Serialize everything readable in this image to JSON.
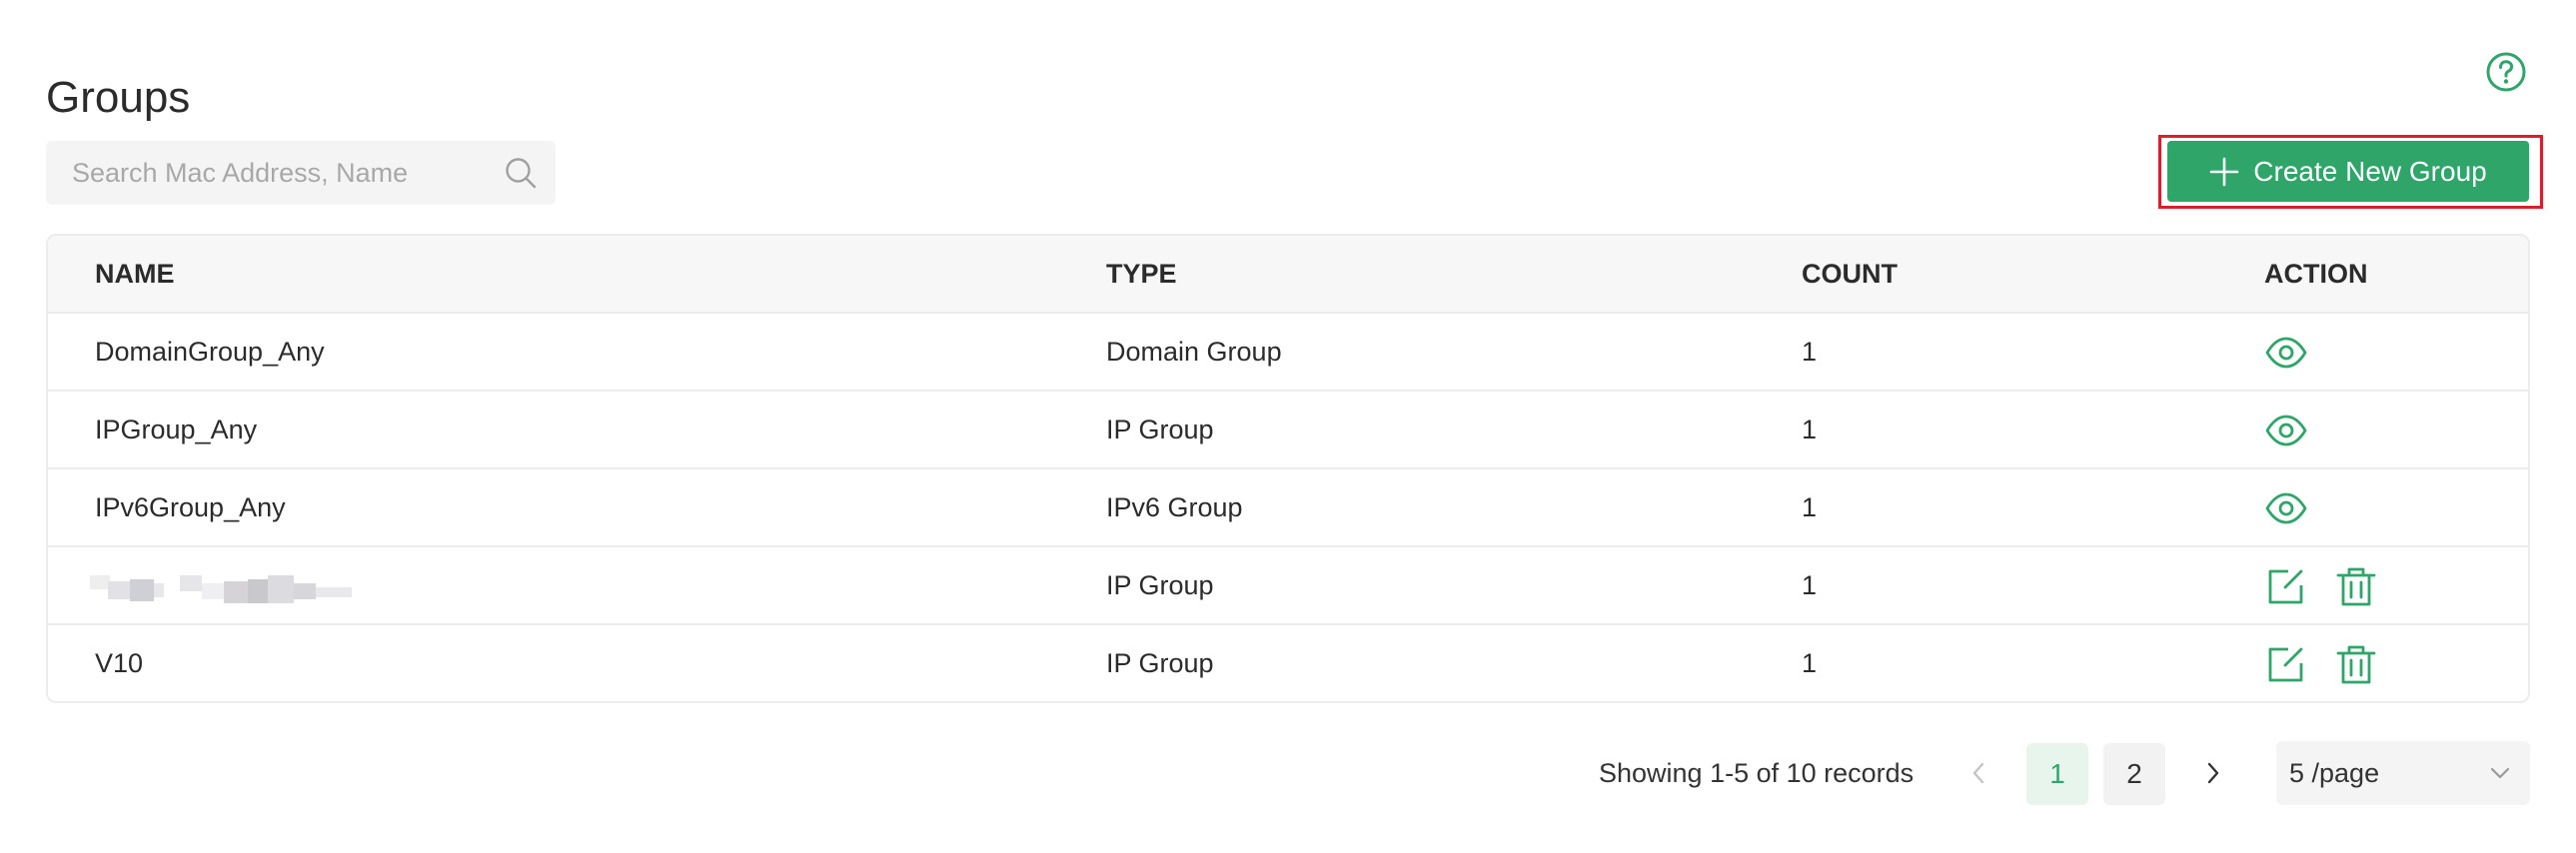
{
  "page": {
    "title": "Groups"
  },
  "search": {
    "placeholder": "Search Mac Address, Name"
  },
  "toolbar": {
    "create_label": "Create New Group"
  },
  "colors": {
    "accent": "#2fa56a",
    "highlight_border": "#d8202c"
  },
  "table": {
    "columns": [
      "NAME",
      "TYPE",
      "COUNT",
      "ACTION"
    ],
    "rows": [
      {
        "name": "DomainGroup_Any",
        "type": "Domain Group",
        "count": "1",
        "actions": [
          "view-icon"
        ]
      },
      {
        "name": "IPGroup_Any",
        "type": "IP Group",
        "count": "1",
        "actions": [
          "view-icon"
        ]
      },
      {
        "name": "IPv6Group_Any",
        "type": "IPv6 Group",
        "count": "1",
        "actions": [
          "view-icon"
        ]
      },
      {
        "name": "",
        "name_obscured": true,
        "type": "IP Group",
        "count": "1",
        "actions": [
          "edit-icon",
          "delete-icon"
        ]
      },
      {
        "name": "V10",
        "type": "IP Group",
        "count": "1",
        "actions": [
          "edit-icon",
          "delete-icon"
        ]
      }
    ]
  },
  "pagination": {
    "info": "Showing 1-5 of 10 records",
    "pages": [
      "1",
      "2"
    ],
    "current_page": "1",
    "page_size": "5 /page"
  }
}
